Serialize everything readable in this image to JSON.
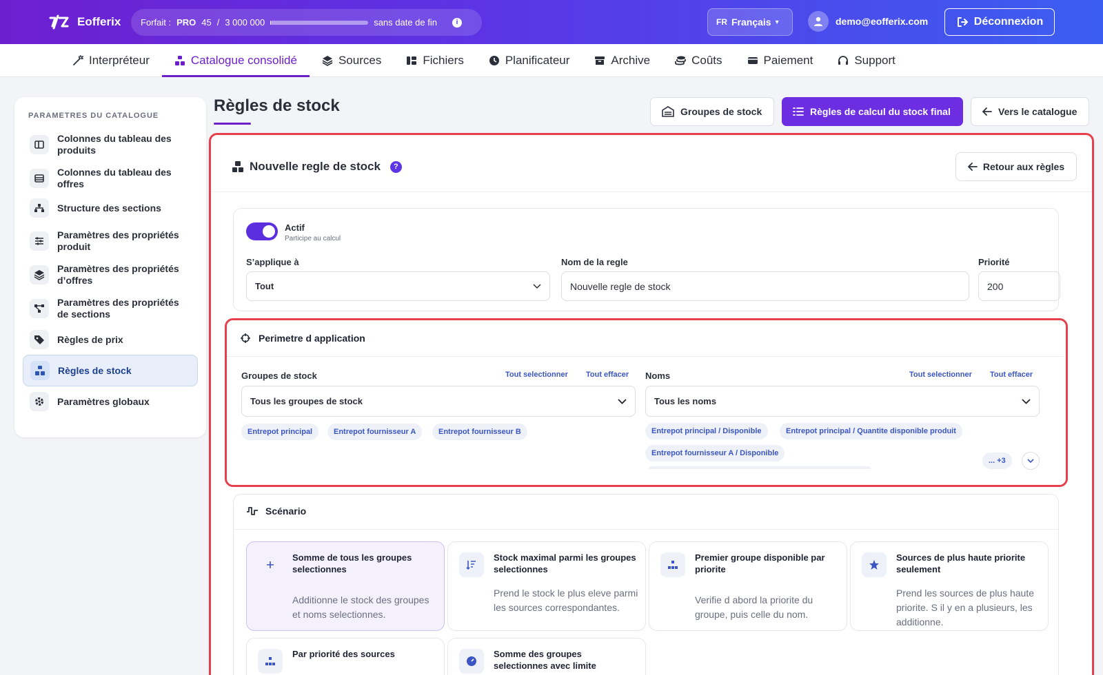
{
  "topbar": {
    "brand": "Eofferix",
    "plan_label": "Forfait :",
    "plan_name": "PRO",
    "plan_used": "45",
    "plan_sep": "/",
    "plan_limit": "3 000 000",
    "plan_usage_fraction": 1.5e-05,
    "plan_end": "sans date de fin",
    "lang_code": "FR",
    "lang_name": "Français",
    "lang_caret": "▾",
    "user_email": "demo@eofferix.com",
    "logout_label": "Déconnexion"
  },
  "nav": [
    {
      "label": "Interpréteur",
      "icon": "wand-icon"
    },
    {
      "label": "Catalogue consolidé",
      "icon": "catalog-icon",
      "active": true
    },
    {
      "label": "Sources",
      "icon": "layers-icon"
    },
    {
      "label": "Fichiers",
      "icon": "files-icon"
    },
    {
      "label": "Planificateur",
      "icon": "clock-icon"
    },
    {
      "label": "Archive",
      "icon": "archive-icon"
    },
    {
      "label": "Coûts",
      "icon": "coins-icon"
    },
    {
      "label": "Paiement",
      "icon": "card-icon"
    },
    {
      "label": "Support",
      "icon": "headset-icon"
    }
  ],
  "sidebar": {
    "title": "PARAMETRES DU CATALOGUE",
    "items": [
      {
        "label": "Colonnes du tableau des produits"
      },
      {
        "label": "Colonnes du tableau des offres"
      },
      {
        "label": "Structure des sections"
      },
      {
        "label": "Paramètres des propriétés produit"
      },
      {
        "label": "Paramètres des propriétés d’offres"
      },
      {
        "label": "Paramètres des propriétés de sections"
      },
      {
        "label": "Règles de prix"
      },
      {
        "label": "Règles de stock",
        "active": true
      },
      {
        "label": "Paramètres globaux"
      }
    ]
  },
  "page": {
    "title": "Règles de stock",
    "btn_groups": "Groupes de stock",
    "btn_rules": "Règles de calcul du stock final",
    "btn_catalog": "Vers le catalogue"
  },
  "form": {
    "heading": "Nouvelle regle de stock",
    "help": "?",
    "back_label": "Retour aux règles",
    "active_label": "Actif",
    "active_hint": "Participe au calcul",
    "applies_label": "S’applique à",
    "applies_value": "Tout",
    "name_label": "Nom de la regle",
    "name_value": "Nouvelle regle de stock",
    "priority_label": "Priorité",
    "priority_value": "200"
  },
  "scope": {
    "title": "Perimetre d application",
    "groups_label": "Groupes de stock",
    "select_all": "Tout selectionner",
    "clear_all": "Tout effacer",
    "groups_value": "Tous les groupes de stock",
    "groups_chips": [
      "Entrepot principal",
      "Entrepot fournisseur A",
      "Entrepot fournisseur B"
    ],
    "names_label": "Noms",
    "names_value": "Tous les noms",
    "names_chips": [
      "Entrepot principal / Disponible",
      "Entrepot principal / Quantite disponible produit",
      "Entrepot fournisseur A / Disponible"
    ],
    "more": "... +3"
  },
  "scenario": {
    "title": "Scénario",
    "cards": [
      {
        "title": "Somme de tous les groupes selectionnes",
        "desc": "Additionne le stock des groupes et noms selectionnes.",
        "icon": "plus-icon"
      },
      {
        "title": "Stock maximal parmi les groupes selectionnes",
        "desc": "Prend le stock le plus eleve parmi les sources correspondantes.",
        "icon": "sort-desc-icon"
      },
      {
        "title": "Premier groupe disponible par priorite",
        "desc": "Verifie d abord la priorite du groupe, puis celle du nom.",
        "icon": "hierarchy-icon"
      },
      {
        "title": "Sources de plus haute priorite seulement",
        "desc": "Prend les sources de plus haute priorite. S il y en a plusieurs, les additionne.",
        "icon": "star-icon"
      },
      {
        "title": "Par priorité des sources",
        "desc": "",
        "icon": "hierarchy-icon"
      },
      {
        "title": "Somme des groupes selectionnes avec limite",
        "desc": "",
        "icon": "gauge-icon"
      }
    ]
  }
}
